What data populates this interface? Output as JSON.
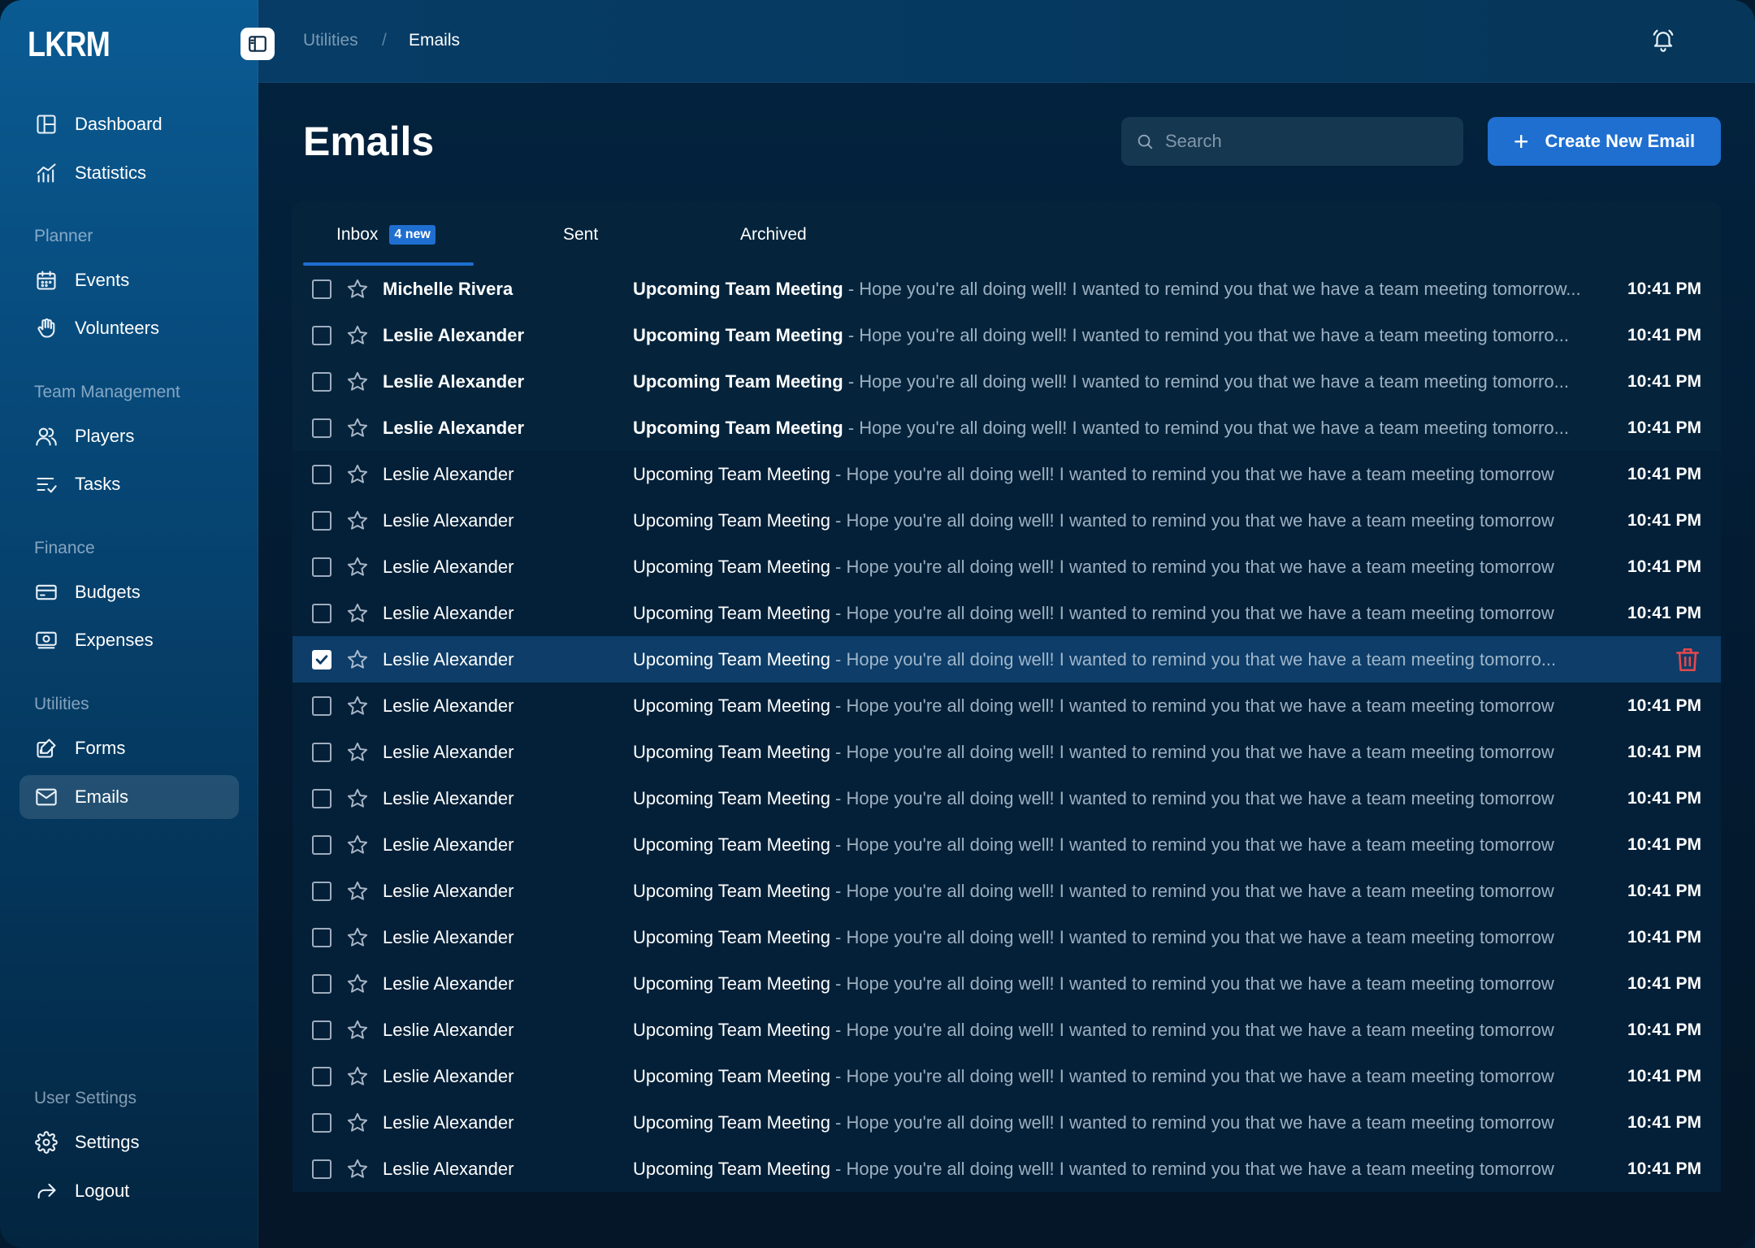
{
  "app": {
    "logo": "LKRM"
  },
  "sidebar": {
    "items_top": [
      {
        "label": "Dashboard",
        "icon": "dashboard-icon"
      },
      {
        "label": "Statistics",
        "icon": "statistics-icon"
      }
    ],
    "sections": [
      {
        "title": "Planner",
        "items": [
          {
            "label": "Events",
            "icon": "calendar-icon"
          },
          {
            "label": "Volunteers",
            "icon": "hand-icon"
          }
        ]
      },
      {
        "title": "Team Management",
        "items": [
          {
            "label": "Players",
            "icon": "users-icon"
          },
          {
            "label": "Tasks",
            "icon": "tasks-icon"
          }
        ]
      },
      {
        "title": "Finance",
        "items": [
          {
            "label": "Budgets",
            "icon": "card-icon"
          },
          {
            "label": "Expenses",
            "icon": "cash-icon"
          }
        ]
      },
      {
        "title": "Utilities",
        "items": [
          {
            "label": "Forms",
            "icon": "form-icon"
          },
          {
            "label": "Emails",
            "icon": "mail-icon"
          }
        ]
      }
    ],
    "user_settings": {
      "title": "User Settings",
      "items": [
        {
          "label": "Settings",
          "icon": "gear-icon"
        },
        {
          "label": "Logout",
          "icon": "logout-icon"
        }
      ]
    }
  },
  "header": {
    "breadcrumb": [
      "Utilities",
      "/",
      "Emails"
    ]
  },
  "main": {
    "title": "Emails",
    "search_placeholder": "Search",
    "create_label": "Create New Email",
    "tabs": [
      {
        "label": "Inbox",
        "badge": "4 new"
      },
      {
        "label": "Sent"
      },
      {
        "label": "Archived"
      }
    ]
  },
  "emails": [
    {
      "sender": "Michelle Rivera",
      "subject": "Upcoming Team Meeting",
      "preview": " - Hope you're all doing well! I wanted to remind you that we have a team meeting tomorrow...",
      "time": "10:41 PM",
      "state": "unread",
      "checked": false
    },
    {
      "sender": "Leslie Alexander",
      "subject": "Upcoming Team Meeting",
      "preview": " - Hope you're all doing well! I wanted to remind you that we have a team meeting tomorro...",
      "time": "10:41 PM",
      "state": "unread",
      "checked": false
    },
    {
      "sender": "Leslie Alexander",
      "subject": "Upcoming Team Meeting",
      "preview": " - Hope you're all doing well! I wanted to remind you that we have a team meeting tomorro...",
      "time": "10:41 PM",
      "state": "unread",
      "checked": false
    },
    {
      "sender": "Leslie Alexander",
      "subject": "Upcoming Team Meeting",
      "preview": " - Hope you're all doing well! I wanted to remind you that we have a team meeting tomorro...",
      "time": "10:41 PM",
      "state": "unread",
      "checked": false
    },
    {
      "sender": "Leslie Alexander",
      "subject": "Upcoming Team Meeting",
      "preview": " - Hope you're all doing well! I wanted to remind you that we have a team meeting tomorrow",
      "time": "10:41 PM",
      "state": "read",
      "checked": false
    },
    {
      "sender": "Leslie Alexander",
      "subject": "Upcoming Team Meeting",
      "preview": " - Hope you're all doing well! I wanted to remind you that we have a team meeting tomorrow",
      "time": "10:41 PM",
      "state": "read",
      "checked": false
    },
    {
      "sender": "Leslie Alexander",
      "subject": "Upcoming Team Meeting",
      "preview": " - Hope you're all doing well! I wanted to remind you that we have a team meeting tomorrow",
      "time": "10:41 PM",
      "state": "read",
      "checked": false
    },
    {
      "sender": "Leslie Alexander",
      "subject": "Upcoming Team Meeting",
      "preview": " - Hope you're all doing well! I wanted to remind you that we have a team meeting tomorrow",
      "time": "10:41 PM",
      "state": "read",
      "checked": false
    },
    {
      "sender": "Leslie Alexander",
      "subject": "Upcoming Team Meeting",
      "preview": " - Hope you're all doing well! I wanted to remind you that we have a team meeting tomorro...",
      "time": "",
      "state": "selected",
      "checked": true
    },
    {
      "sender": "Leslie Alexander",
      "subject": "Upcoming Team Meeting",
      "preview": " - Hope you're all doing well! I wanted to remind you that we have a team meeting tomorrow",
      "time": "10:41 PM",
      "state": "read",
      "checked": false
    },
    {
      "sender": "Leslie Alexander",
      "subject": "Upcoming Team Meeting",
      "preview": " - Hope you're all doing well! I wanted to remind you that we have a team meeting tomorrow",
      "time": "10:41 PM",
      "state": "read",
      "checked": false
    },
    {
      "sender": "Leslie Alexander",
      "subject": "Upcoming Team Meeting",
      "preview": " - Hope you're all doing well! I wanted to remind you that we have a team meeting tomorrow",
      "time": "10:41 PM",
      "state": "read",
      "checked": false
    },
    {
      "sender": "Leslie Alexander",
      "subject": "Upcoming Team Meeting",
      "preview": " - Hope you're all doing well! I wanted to remind you that we have a team meeting tomorrow",
      "time": "10:41 PM",
      "state": "read",
      "checked": false
    },
    {
      "sender": "Leslie Alexander",
      "subject": "Upcoming Team Meeting",
      "preview": " - Hope you're all doing well! I wanted to remind you that we have a team meeting tomorrow",
      "time": "10:41 PM",
      "state": "read",
      "checked": false
    },
    {
      "sender": "Leslie Alexander",
      "subject": "Upcoming Team Meeting",
      "preview": " - Hope you're all doing well! I wanted to remind you that we have a team meeting tomorrow",
      "time": "10:41 PM",
      "state": "read",
      "checked": false
    },
    {
      "sender": "Leslie Alexander",
      "subject": "Upcoming Team Meeting",
      "preview": " - Hope you're all doing well! I wanted to remind you that we have a team meeting tomorrow",
      "time": "10:41 PM",
      "state": "read",
      "checked": false
    },
    {
      "sender": "Leslie Alexander",
      "subject": "Upcoming Team Meeting",
      "preview": " - Hope you're all doing well! I wanted to remind you that we have a team meeting tomorrow",
      "time": "10:41 PM",
      "state": "read",
      "checked": false
    },
    {
      "sender": "Leslie Alexander",
      "subject": "Upcoming Team Meeting",
      "preview": " - Hope you're all doing well! I wanted to remind you that we have a team meeting tomorrow",
      "time": "10:41 PM",
      "state": "read",
      "checked": false
    },
    {
      "sender": "Leslie Alexander",
      "subject": "Upcoming Team Meeting",
      "preview": " - Hope you're all doing well! I wanted to remind you that we have a team meeting tomorrow",
      "time": "10:41 PM",
      "state": "read",
      "checked": false
    },
    {
      "sender": "Leslie Alexander",
      "subject": "Upcoming Team Meeting",
      "preview": " - Hope you're all doing well! I wanted to remind you that we have a team meeting tomorrow",
      "time": "10:41 PM",
      "state": "read",
      "checked": false
    }
  ],
  "colors": {
    "accent": "#1f6fd1",
    "danger": "#e5484d",
    "sidebar_top": "#0a5b93"
  }
}
